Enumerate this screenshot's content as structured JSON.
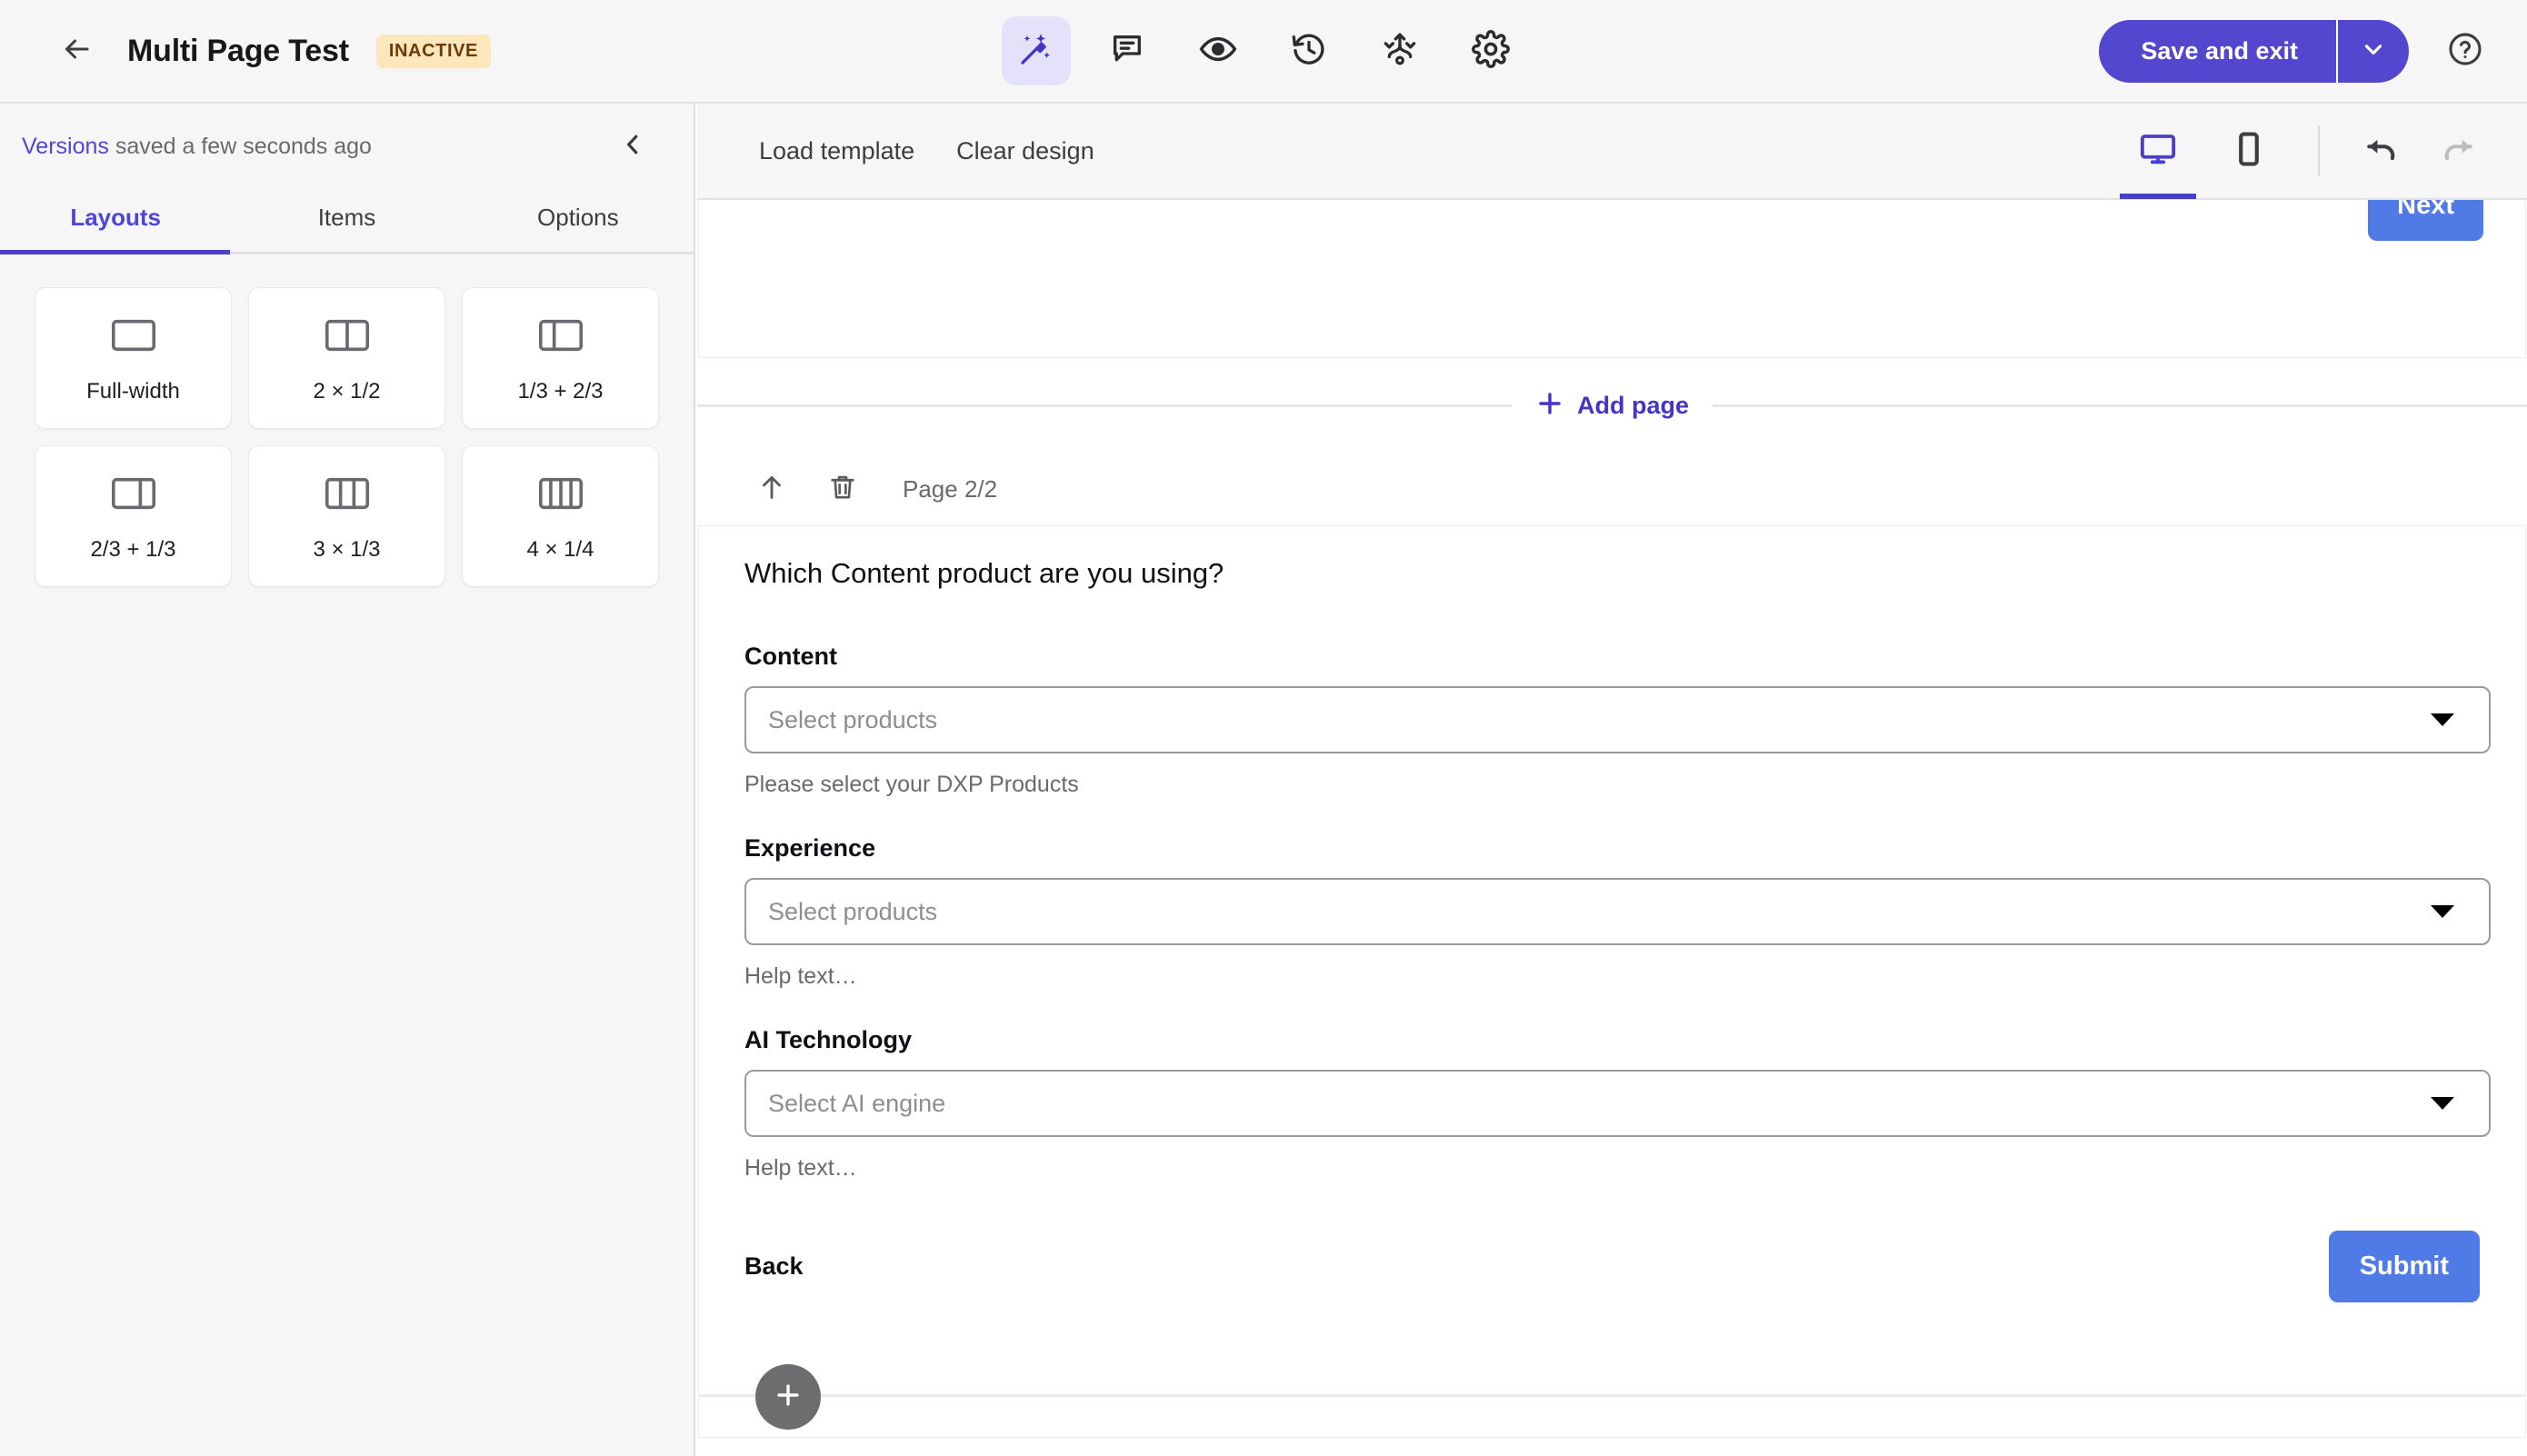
{
  "header": {
    "back_icon": "arrow-left-icon",
    "title": "Multi Page Test",
    "status": "INACTIVE",
    "tools": [
      {
        "name": "design-icon",
        "label": "Design",
        "active": true
      },
      {
        "name": "comment-icon",
        "label": "Comments",
        "active": false
      },
      {
        "name": "preview-eye-icon",
        "label": "Preview",
        "active": false
      },
      {
        "name": "history-icon",
        "label": "History",
        "active": false
      },
      {
        "name": "routing-icon",
        "label": "Routing",
        "active": false
      },
      {
        "name": "gear-icon",
        "label": "Settings",
        "active": false
      }
    ],
    "save_label": "Save and exit",
    "save_caret_icon": "chevron-down-icon",
    "help_icon": "question-circle-icon"
  },
  "sidebar": {
    "versions_link": "Versions",
    "versions_status": " saved a few seconds ago",
    "collapse_icon": "chevron-left-icon",
    "tabs": [
      {
        "label": "Layouts",
        "active": true
      },
      {
        "label": "Items",
        "active": false
      },
      {
        "label": "Options",
        "active": false
      }
    ],
    "layouts": [
      {
        "label": "Full-width",
        "icon": "layout-full-icon",
        "cols": [
          1
        ]
      },
      {
        "label": "2 × 1/2",
        "icon": "layout-2x12-icon",
        "cols": [
          1,
          1
        ]
      },
      {
        "label": "1/3 + 2/3",
        "icon": "layout-13-23-icon",
        "cols": [
          1,
          2
        ]
      },
      {
        "label": "2/3 + 1/3",
        "icon": "layout-23-13-icon",
        "cols": [
          2,
          1
        ]
      },
      {
        "label": "3 × 1/3",
        "icon": "layout-3x13-icon",
        "cols": [
          1,
          1,
          1
        ]
      },
      {
        "label": "4 × 1/4",
        "icon": "layout-4x14-icon",
        "cols": [
          1,
          1,
          1,
          1
        ]
      }
    ]
  },
  "canvas_toolbar": {
    "load_template": "Load template",
    "clear_design": "Clear design",
    "desktop_icon": "desktop-icon",
    "mobile_icon": "mobile-icon",
    "undo_icon": "undo-icon",
    "redo_icon": "redo-icon",
    "active_device": "desktop"
  },
  "canvas": {
    "next_button": "Next",
    "add_page": {
      "icon": "plus-icon",
      "label": "Add page"
    },
    "page_toolbar": {
      "move_up_icon": "arrow-up-icon",
      "delete_icon": "trash-icon",
      "page_indicator": "Page 2/2"
    },
    "form": {
      "question": "Which Content product are you using?",
      "fields": [
        {
          "label": "Content",
          "placeholder": "Select products",
          "help": "Please select your DXP Products"
        },
        {
          "label": "Experience",
          "placeholder": "Select products",
          "help": "Help text…"
        },
        {
          "label": "AI Technology",
          "placeholder": "Select AI engine",
          "help": "Help text…"
        }
      ],
      "back_label": "Back",
      "submit_label": "Submit"
    },
    "fab_icon": "plus-icon"
  },
  "colors": {
    "brand_purple": "#5247ce",
    "accent_purple": "#4f46d8",
    "button_blue": "#507ae6",
    "badge_bg": "#fbe7bb",
    "badge_text": "#6b3a06",
    "panel_bg": "#f6f6f7"
  }
}
